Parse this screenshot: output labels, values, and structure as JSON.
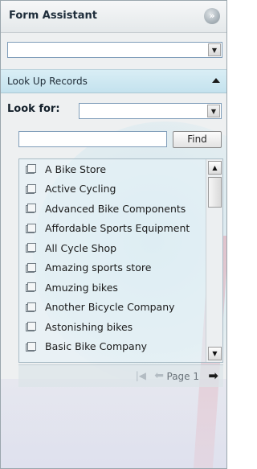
{
  "header": {
    "title": "Form Assistant",
    "collapse_glyph": "»",
    "collapse_icon": "double-chevron-right-icon"
  },
  "top_combo": {
    "value": ""
  },
  "section": {
    "title": "Look Up Records",
    "toggle_icon": "triangle-up-icon"
  },
  "lookup": {
    "lookfor_label": "Look for:",
    "lookfor_value": "",
    "search_value": "",
    "find_label": "Find"
  },
  "records": [
    {
      "label": "A Bike Store"
    },
    {
      "label": "Active Cycling"
    },
    {
      "label": "Advanced Bike Components"
    },
    {
      "label": "Affordable Sports Equipment"
    },
    {
      "label": "All Cycle Shop"
    },
    {
      "label": "Amazing sports store"
    },
    {
      "label": "Amuzing bikes"
    },
    {
      "label": "Another Bicycle Company"
    },
    {
      "label": "Astonishing bikes"
    },
    {
      "label": "Basic Bike Company"
    }
  ],
  "pager": {
    "first_glyph": "|◀",
    "prev_glyph": "⬅",
    "page_label": "Page 1",
    "next_glyph": "➡"
  },
  "colors": {
    "section_band": "#c4e2ee",
    "pane_bg": "#eef0f1",
    "accent_pink": "#e1bec8"
  }
}
